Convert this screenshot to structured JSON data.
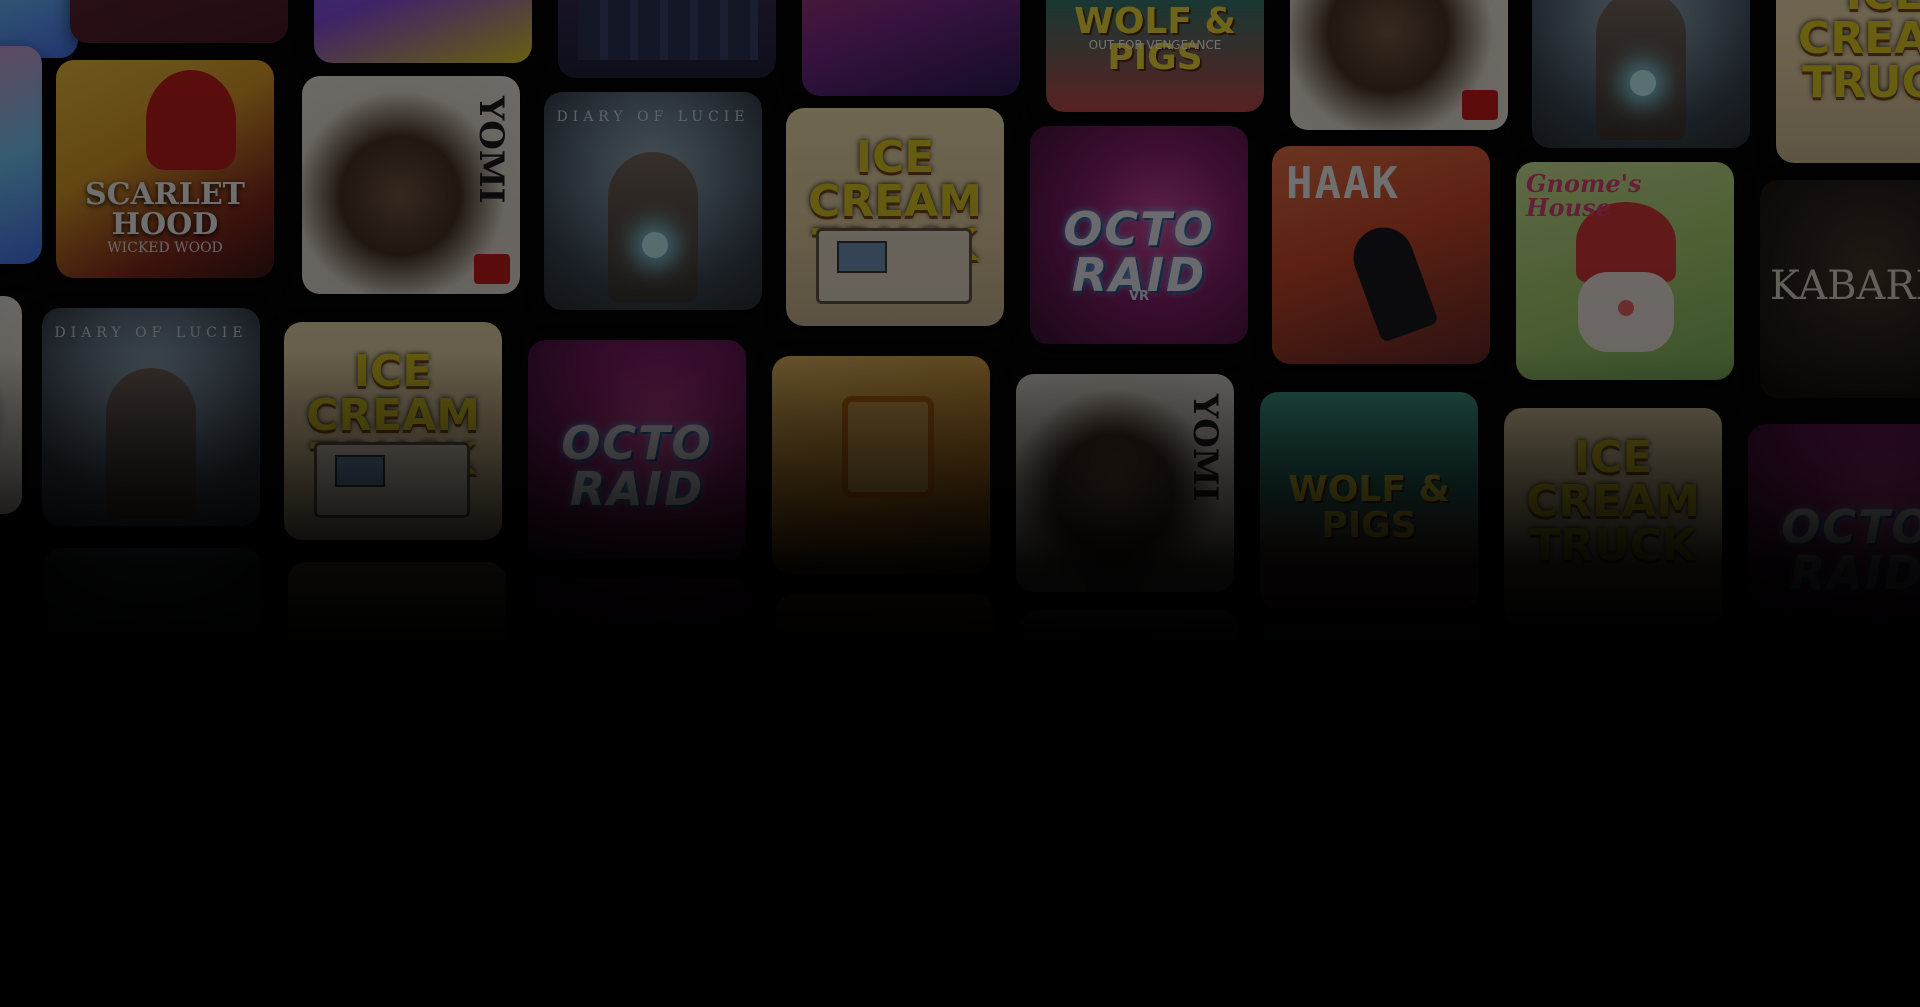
{
  "wall": {
    "tiles": {
      "scarlet": {
        "title": "SCARLET\nHOOD",
        "sub": "WICKED WOOD"
      },
      "yomi": {
        "title": "YOMI"
      },
      "lucie": {
        "title": "DIARY OF LUCIE"
      },
      "icecream": {
        "title": "ICE CREAM TRUCK"
      },
      "octo": {
        "title": "OCTO RAID",
        "sub": "VR"
      },
      "haak": {
        "title": "HAAK"
      },
      "gnome": {
        "title": "Gnome's House"
      },
      "kabaret": {
        "title": "KABARET"
      },
      "wolf": {
        "title": "WOLF & PIGS",
        "sub": "OUT FOR VENGEANCE"
      }
    }
  },
  "colors": {
    "background": "#050506",
    "fade": "#000000"
  }
}
